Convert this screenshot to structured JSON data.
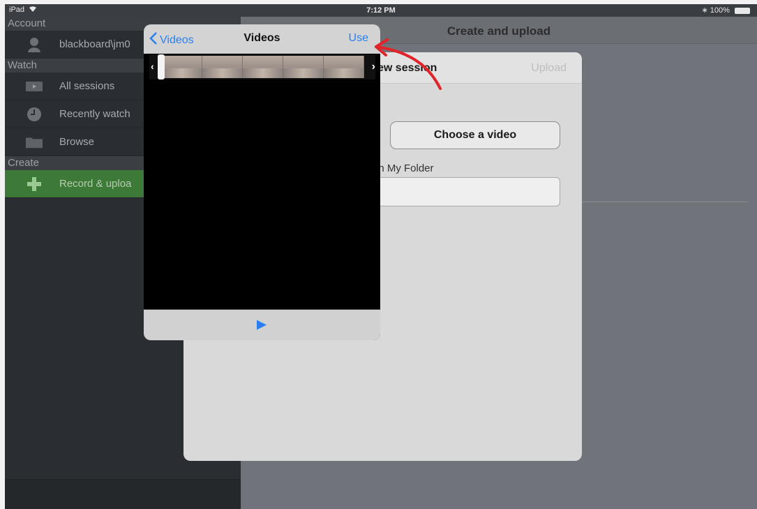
{
  "status_bar": {
    "device": "iPad",
    "time": "7:12 PM",
    "battery": "100%"
  },
  "sidebar": {
    "sections": [
      {
        "label": "Account",
        "items": [
          {
            "label": "blackboard\\jm0",
            "icon": "user-icon"
          }
        ]
      },
      {
        "label": "Watch",
        "items": [
          {
            "label": "All sessions",
            "icon": "film-icon"
          },
          {
            "label": "Recently watch",
            "icon": "clock-icon"
          },
          {
            "label": "Browse",
            "icon": "folder-icon"
          }
        ]
      },
      {
        "label": "Create",
        "items": [
          {
            "label": "Record & uploa",
            "icon": "plus-icon",
            "active": true
          }
        ]
      }
    ]
  },
  "main": {
    "title": "Create and upload"
  },
  "sheet": {
    "title": "ew session",
    "upload_label": "Upload",
    "choose_video_label": "Choose a video",
    "folder_label": "in My Folder"
  },
  "popover": {
    "back_label": "Videos",
    "title": "Videos",
    "use_label": "Use",
    "trim_frames": 5
  },
  "colors": {
    "accent_blue": "#2a7ff0",
    "sidebar_active": "#3d7a37",
    "annotation_red": "#e0242a"
  }
}
